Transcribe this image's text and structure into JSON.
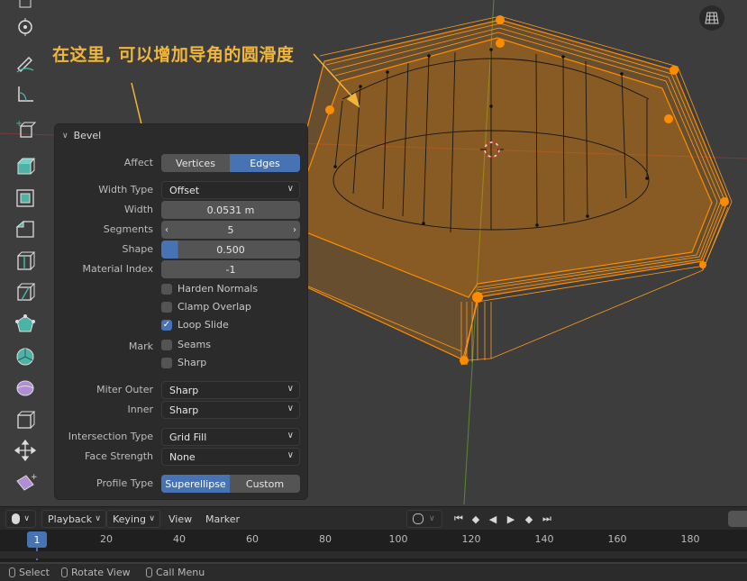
{
  "annotation": {
    "text": "在这里, 可以增加导角的圆滑度"
  },
  "viewport": {
    "gizmo_icon": "perspective-grid-icon"
  },
  "toolbar": {
    "tools": [
      "select-box-icon",
      "cursor-icon",
      "annotate-icon",
      "measure-icon",
      "add-cube-icon",
      "extrude-icon",
      "inset-icon",
      "bevel-icon",
      "loop-cut-icon",
      "knife-icon",
      "poly-build-icon",
      "spin-icon",
      "smooth-icon",
      "edge-slide-icon",
      "shrink-fatten-icon",
      "shear-icon",
      "rip-icon"
    ]
  },
  "bevel_panel": {
    "title": "Bevel",
    "affect": {
      "label": "Affect",
      "options": [
        "Vertices",
        "Edges"
      ],
      "selected": "Edges"
    },
    "width_type": {
      "label": "Width Type",
      "value": "Offset"
    },
    "width": {
      "label": "Width",
      "value": "0.0531 m"
    },
    "segments": {
      "label": "Segments",
      "value": "5"
    },
    "shape": {
      "label": "Shape",
      "value": "0.500",
      "fraction": 0.12
    },
    "material_index": {
      "label": "Material Index",
      "value": "-1"
    },
    "harden_normals": {
      "label": "Harden Normals",
      "checked": false
    },
    "clamp_overlap": {
      "label": "Clamp Overlap",
      "checked": false
    },
    "loop_slide": {
      "label": "Loop Slide",
      "checked": true
    },
    "mark": {
      "label": "Mark",
      "seams": "Seams",
      "sharp": "Sharp",
      "seams_checked": false,
      "sharp_checked": false
    },
    "miter_outer": {
      "label": "Miter Outer",
      "value": "Sharp"
    },
    "inner": {
      "label": "Inner",
      "value": "Sharp"
    },
    "intersection_type": {
      "label": "Intersection Type",
      "value": "Grid Fill"
    },
    "face_strength": {
      "label": "Face Strength",
      "value": "None"
    },
    "profile_type": {
      "label": "Profile Type",
      "options": [
        "Superellipse",
        "Custom"
      ],
      "selected": "Superellipse"
    }
  },
  "timeline": {
    "menus": [
      "Playback",
      "Keying",
      "View",
      "Marker"
    ],
    "current_frame": "1",
    "frame_labels": [
      "20",
      "40",
      "60",
      "80",
      "100",
      "120",
      "140",
      "160",
      "180"
    ]
  },
  "statusbar": {
    "items": [
      "Select",
      "Rotate View",
      "Call Menu"
    ]
  },
  "colors": {
    "accent": "#4772b3",
    "selection_orange": "#ff8c00",
    "annotation": "#f0b63a"
  }
}
